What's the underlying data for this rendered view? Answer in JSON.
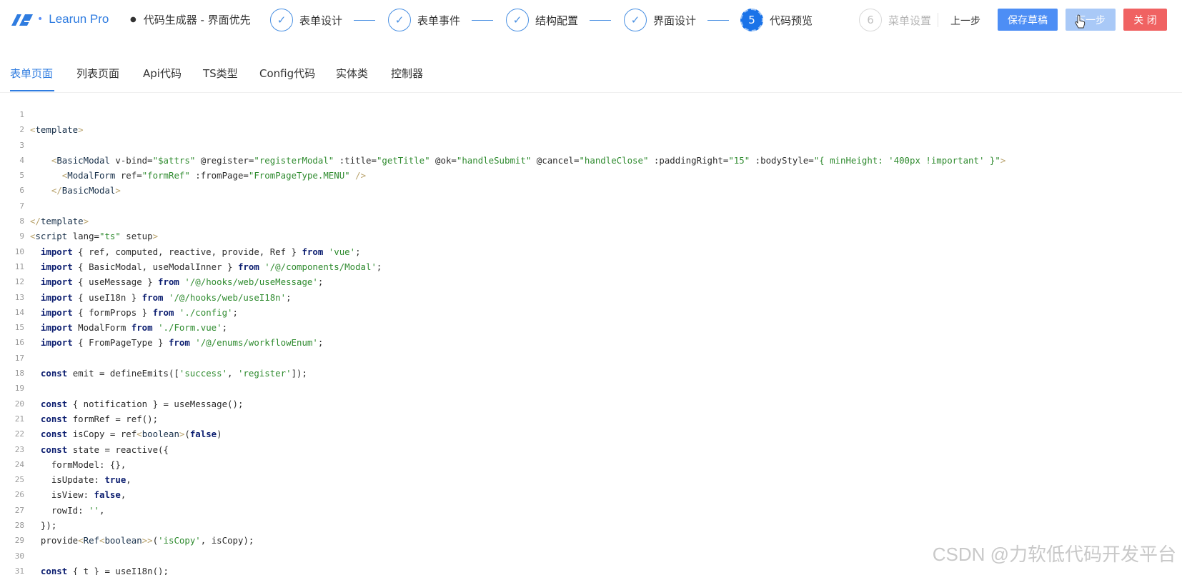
{
  "header": {
    "logo_text": "Learun Pro",
    "breadcrumb": "代码生成器 - 界面优先",
    "steps": [
      {
        "label": "表单设计",
        "state": "done"
      },
      {
        "label": "表单事件",
        "state": "done"
      },
      {
        "label": "结构配置",
        "state": "done"
      },
      {
        "label": "界面设计",
        "state": "done"
      },
      {
        "label": "代码预览",
        "state": "active",
        "number": "5"
      },
      {
        "label": "菜单设置",
        "state": "pending",
        "number": "6"
      }
    ],
    "prev_label": "上一步",
    "save_draft_label": "保存草稿",
    "next_label": "下一步",
    "close_label": "关 闭",
    "check_glyph": "✓"
  },
  "tabs": [
    {
      "label": "表单页面",
      "active": true
    },
    {
      "label": "列表页面",
      "active": false
    },
    {
      "label": "Api代码",
      "active": false
    },
    {
      "label": "TS类型",
      "active": false
    },
    {
      "label": "Config代码",
      "active": false
    },
    {
      "label": "实体类",
      "active": false
    },
    {
      "label": "控制器",
      "active": false
    }
  ],
  "code_lines": [
    "",
    "<template>",
    "",
    "    <BasicModal v-bind=\"$attrs\" @register=\"registerModal\" :title=\"getTitle\" @ok=\"handleSubmit\" @cancel=\"handleClose\" :paddingRight=\"15\" :bodyStyle=\"{ minHeight: '400px !important' }\">",
    "      <ModalForm ref=\"formRef\" :fromPage=\"FromPageType.MENU\" />",
    "    </BasicModal>",
    "",
    "</template>",
    "<script lang=\"ts\" setup>",
    "  import { ref, computed, reactive, provide, Ref } from 'vue';",
    "  import { BasicModal, useModalInner } from '/@/components/Modal';",
    "  import { useMessage } from '/@/hooks/web/useMessage';",
    "  import { useI18n } from '/@/hooks/web/useI18n';",
    "  import { formProps } from './config';",
    "  import ModalForm from './Form.vue';",
    "  import { FromPageType } from '/@/enums/workflowEnum';",
    "",
    "  const emit = defineEmits(['success', 'register']);",
    "",
    "  const { notification } = useMessage();",
    "  const formRef = ref();",
    "  const isCopy = ref<boolean>(false)",
    "  const state = reactive({",
    "    formModel: {},",
    "    isUpdate: true,",
    "    isView: false,",
    "    rowId: '',",
    "  });",
    "  provide<Ref<boolean>>('isCopy', isCopy);",
    "",
    "  const { t } = useI18n();"
  ],
  "watermark": "CSDN @力软低代码开发平台",
  "colors": {
    "accent": "#2f7ce0",
    "primary_button": "#4d8ef5",
    "danger_button": "#f06262",
    "keyword": "#0c1e70",
    "string": "#2f8b2f"
  }
}
